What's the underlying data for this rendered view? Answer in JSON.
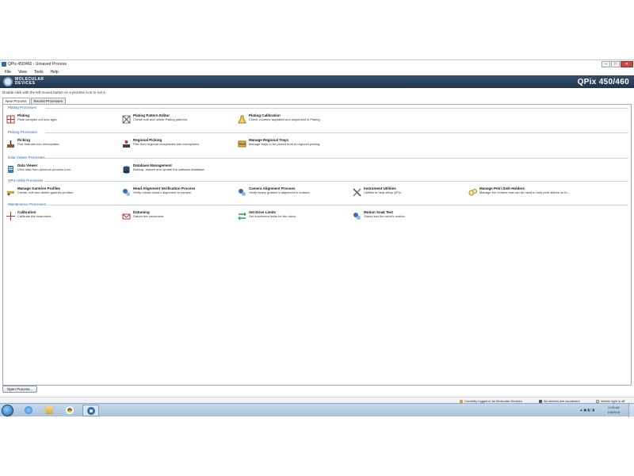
{
  "window": {
    "title": "QPix 450/460 - Unsaved Process",
    "minimize": "–",
    "maximize": "□",
    "close": "✕"
  },
  "menu": [
    "File",
    "View",
    "Tools",
    "Help"
  ],
  "banner": {
    "logo_line1": "MOLECULAR",
    "logo_line2": "DEVICES",
    "product": "QPix 450/460"
  },
  "hint": "Double click with the left mouse button on a process icon to run it.",
  "tabs": [
    {
      "label": "New Process"
    },
    {
      "label": "Recent Processes"
    }
  ],
  "sections": [
    {
      "label": "Plating Processes",
      "items": [
        {
          "name": "Plating",
          "desc": "Plate samples out onto agar.",
          "icon": "plating-icon"
        },
        {
          "name": "Plating Pattern Editor",
          "desc": "Create edit and delete Plating patterns.",
          "icon": "pattern-editor-icon"
        },
        {
          "name": "Plating Calibration",
          "desc": "Check volumes aspirated and dispensed in Plating.",
          "icon": "calibration-flask-icon"
        }
      ]
    },
    {
      "label": "Picking Processes",
      "items": [
        {
          "name": "Picking",
          "desc": "Pick features into microplates.",
          "icon": "picking-icon"
        },
        {
          "name": "Regional Picking",
          "desc": "Pick from regional receptacles into microplates.",
          "icon": "regional-picking-icon"
        },
        {
          "name": "Manage Regional Trays",
          "desc": "Manage trays to be picked from in regional picking.",
          "icon": "trays-icon"
        }
      ]
    },
    {
      "label": "Data Viewer Processes",
      "items": [
        {
          "name": "Data Viewer",
          "desc": "View data from previous process runs.",
          "icon": "data-viewer-icon"
        },
        {
          "name": "Database Management",
          "desc": "Backup, restore and update the software database.",
          "icon": "database-icon"
        }
      ]
    },
    {
      "label": "QPix Utility Processes",
      "items": [
        {
          "name": "Manage Gantries Profiles",
          "desc": "Create, edit and delete gantries profiles.",
          "icon": "gantry-profiles-icon"
        },
        {
          "name": "Head Alignment Verification Process",
          "desc": "Verify robotic head's alignment to surface.",
          "icon": "head-alignment-icon"
        },
        {
          "name": "Camera Alignment Process",
          "desc": "Verify heavy grabber's alignment to surface.",
          "icon": "camera-alignment-icon"
        },
        {
          "name": "Instrument Utilities",
          "desc": "Utilities to help setup QPix.",
          "icon": "tools-icon"
        },
        {
          "name": "Manage Petri Dish Holders",
          "desc": "Manage the holders that can be used to hold petri dishes on th...",
          "icon": "petri-holder-icon"
        }
      ]
    },
    {
      "label": "Maintenance Processes",
      "items": [
        {
          "name": "Calibration",
          "desc": "Calibrate the instrument.",
          "icon": "crosshair-icon"
        },
        {
          "name": "Datuming",
          "desc": "Datum the instrument.",
          "icon": "datum-icon"
        },
        {
          "name": "Set Drive Limits",
          "desc": "Set movement limits for the robot.",
          "icon": "drive-limits-icon"
        },
        {
          "name": "Motion Soak Test",
          "desc": "Stress test the robot's motion.",
          "icon": "soak-test-icon"
        }
      ]
    }
  ],
  "open_button": "Open Process...",
  "status": {
    "login": "Currently logged in as Molecular Devices",
    "devices": "All devices are connected",
    "light": "Interior light is off"
  },
  "taskbar": {
    "time": "10:25 AM",
    "date": "1/16/2015",
    "tray_icons": "▲ ▣ ◧ ◨"
  },
  "colors": {
    "banner": "#1e3650",
    "section_label": "#2c66a8",
    "taskbar": "#a9c2dc"
  }
}
